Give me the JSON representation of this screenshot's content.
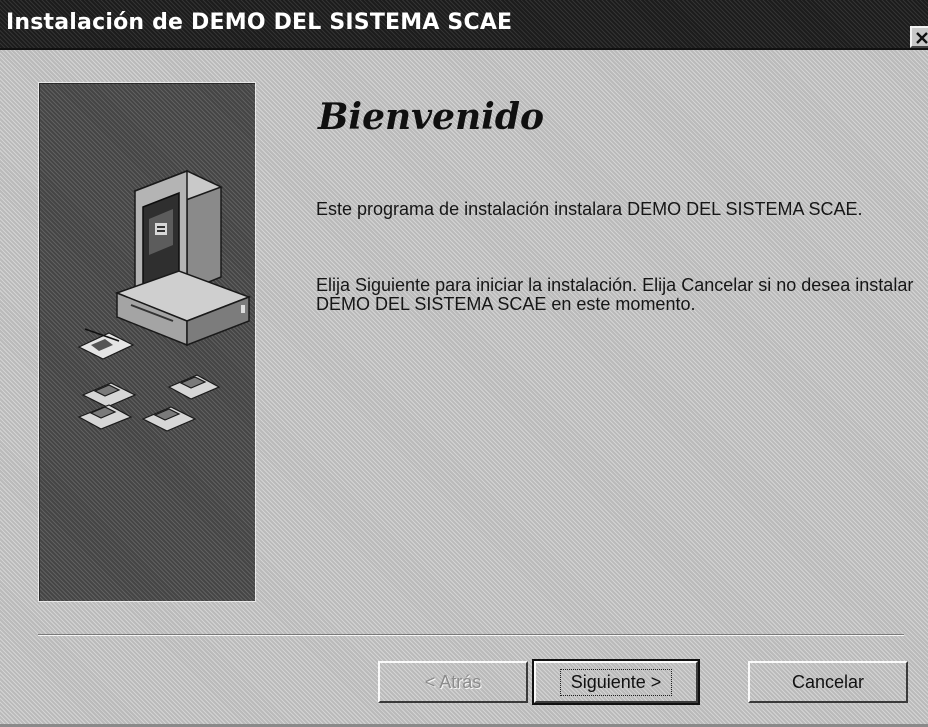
{
  "window": {
    "title": "Instalación de DEMO DEL SISTEMA SCAE",
    "close_icon": "close-icon"
  },
  "panel": {
    "illustration": "computer-with-floppy-disks-icon"
  },
  "content": {
    "heading": "Bienvenido",
    "paragraph1": "Este programa de instalación instalara DEMO DEL SISTEMA SCAE.",
    "paragraph2": "Elija Siguiente para iniciar la instalación. Elija Cancelar si no desea instalar DEMO DEL SISTEMA SCAE en este momento."
  },
  "buttons": {
    "back_label": "< Atrás",
    "back_enabled": false,
    "next_label": "Siguiente >",
    "cancel_label": "Cancelar"
  }
}
